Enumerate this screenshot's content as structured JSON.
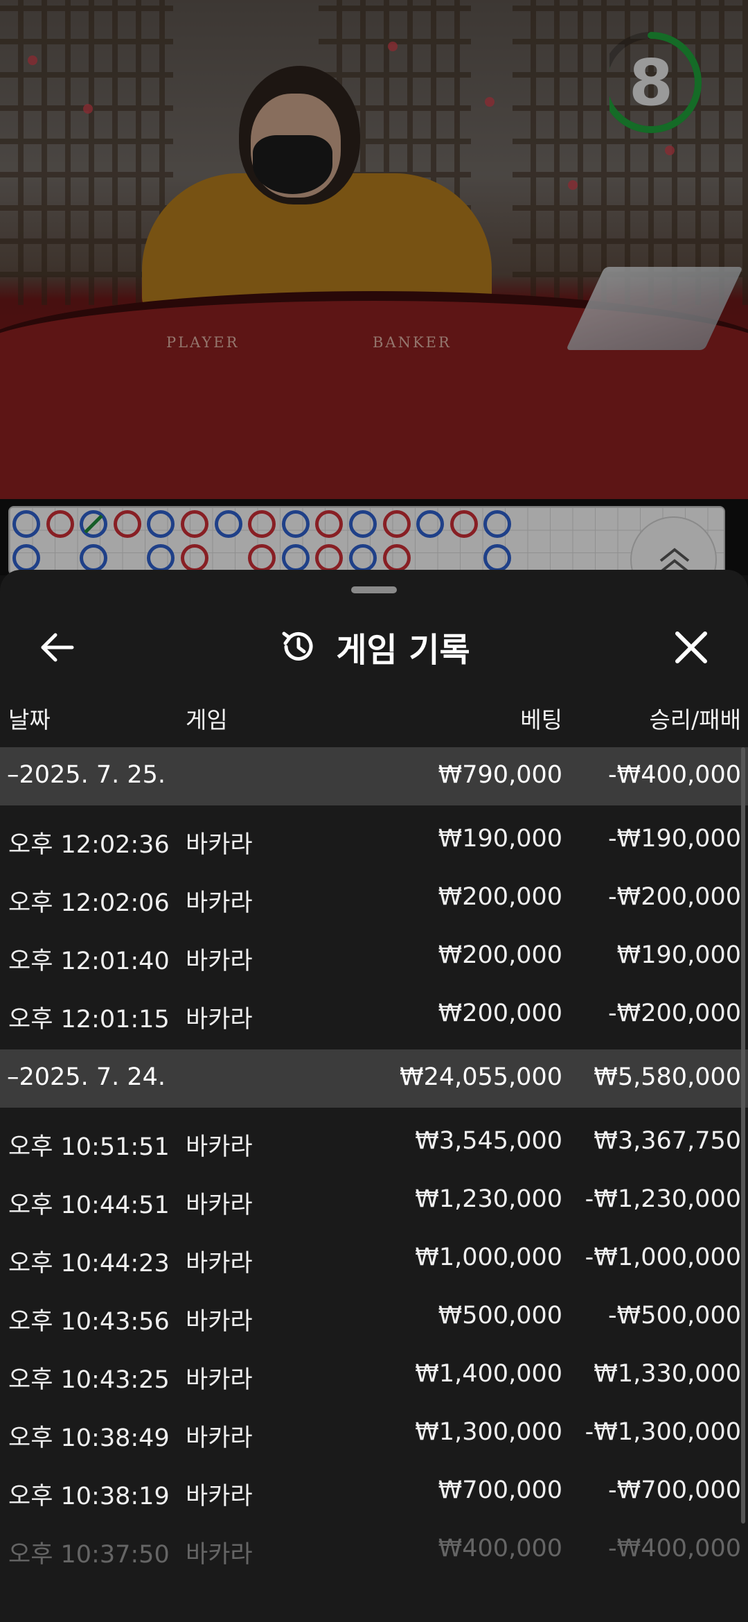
{
  "timer": {
    "value": "8",
    "progress": 0.8,
    "color": "#1f9e3a"
  },
  "table": {
    "player_label": "PLAYER",
    "banker_label": "BANKER"
  },
  "road": {
    "top_row": [
      "P",
      "B",
      "T",
      "B",
      "P",
      "B",
      "P",
      "B",
      "P",
      "B",
      "P",
      "B",
      "P",
      "B",
      "P"
    ],
    "bottom_row": [
      "P",
      "",
      "P",
      "",
      "P",
      "B",
      "",
      "B",
      "P",
      "B",
      "P",
      "B",
      "",
      "",
      "P"
    ]
  },
  "sheet": {
    "title": "게임 기록",
    "icons": {
      "back": "arrow-left-icon",
      "history": "history-icon",
      "close": "close-icon"
    },
    "columns": {
      "date": "날짜",
      "game": "게임",
      "bet": "베팅",
      "result": "승리/패배"
    },
    "groups": [
      {
        "date": "–2025. 7. 25.",
        "bet": "₩790,000",
        "result": "-₩400,000",
        "rows": [
          {
            "time": "오후 12:02:36",
            "game": "바카라",
            "bet": "₩190,000",
            "result": "-₩190,000"
          },
          {
            "time": "오후 12:02:06",
            "game": "바카라",
            "bet": "₩200,000",
            "result": "-₩200,000"
          },
          {
            "time": "오후 12:01:40",
            "game": "바카라",
            "bet": "₩200,000",
            "result": "₩190,000"
          },
          {
            "time": "오후 12:01:15",
            "game": "바카라",
            "bet": "₩200,000",
            "result": "-₩200,000"
          }
        ]
      },
      {
        "date": "–2025. 7. 24.",
        "bet": "₩24,055,000",
        "result": "₩5,580,000",
        "rows": [
          {
            "time": "오후 10:51:51",
            "game": "바카라",
            "bet": "₩3,545,000",
            "result": "₩3,367,750"
          },
          {
            "time": "오후 10:44:51",
            "game": "바카라",
            "bet": "₩1,230,000",
            "result": "-₩1,230,000"
          },
          {
            "time": "오후 10:44:23",
            "game": "바카라",
            "bet": "₩1,000,000",
            "result": "-₩1,000,000"
          },
          {
            "time": "오후 10:43:56",
            "game": "바카라",
            "bet": "₩500,000",
            "result": "-₩500,000"
          },
          {
            "time": "오후 10:43:25",
            "game": "바카라",
            "bet": "₩1,400,000",
            "result": "₩1,330,000"
          },
          {
            "time": "오후 10:38:49",
            "game": "바카라",
            "bet": "₩1,300,000",
            "result": "-₩1,300,000"
          },
          {
            "time": "오후 10:38:19",
            "game": "바카라",
            "bet": "₩700,000",
            "result": "-₩700,000"
          },
          {
            "time": "오후 10:37:50",
            "game": "바카라",
            "bet": "₩400,000",
            "result": "-₩400,000"
          }
        ]
      }
    ]
  }
}
